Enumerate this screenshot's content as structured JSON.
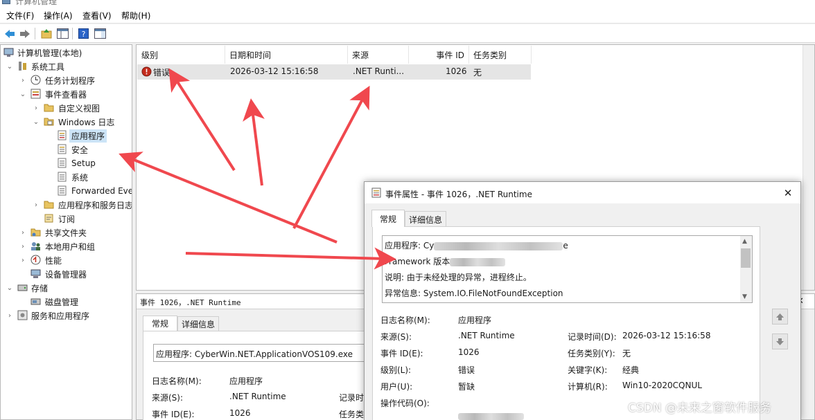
{
  "window": {
    "title": "计算机管理"
  },
  "menu": [
    "文件(F)",
    "操作(A)",
    "查看(V)",
    "帮助(H)"
  ],
  "toolbar_icons": [
    "back-arrow-icon",
    "forward-arrow-icon",
    "up-folder-icon",
    "show-tree-icon",
    "help-icon",
    "action-pane-icon"
  ],
  "tree": {
    "root": "计算机管理(本地)",
    "system_tools": "系统工具",
    "task_scheduler": "任务计划程序",
    "event_viewer": "事件查看器",
    "custom_views": "自定义视图",
    "windows_logs": "Windows 日志",
    "application": "应用程序",
    "security": "安全",
    "setup": "Setup",
    "system": "系统",
    "forwarded": "Forwarded Eve",
    "app_service_logs": "应用程序和服务日志",
    "subscriptions": "订阅",
    "shared_folders": "共享文件夹",
    "local_users": "本地用户和组",
    "performance": "性能",
    "device_manager": "设备管理器",
    "storage": "存储",
    "disk_mgmt": "磁盘管理",
    "services_apps": "服务和应用程序"
  },
  "list": {
    "headers": [
      "级别",
      "日期和时间",
      "来源",
      "事件 ID",
      "任务类别"
    ],
    "row": {
      "level": "错误",
      "datetime": "2026-03-12 15:16:58",
      "source": ".NET Runti...",
      "event_id": "1026",
      "task": "无"
    }
  },
  "preview": {
    "title": "事件 1026，.NET Runtime",
    "tabs": [
      "常规",
      "详细信息"
    ],
    "app_line": "应用程序: CyberWin.NET.ApplicationVOS109.exe",
    "log_name_label": "日志名称(M):",
    "log_name": "应用程序",
    "source_label": "来源(S):",
    "source": ".NET Runtime",
    "event_id_label": "事件 ID(E):",
    "event_id": "1026",
    "recorded_label": "记录时",
    "task_label": "任务类"
  },
  "dialog": {
    "title": "事件属性 - 事件 1026，.NET Runtime",
    "close": "✕",
    "tabs": [
      "常规",
      "详细信息"
    ],
    "desc": {
      "line1_prefix": "应用程序: Cy",
      "line1_suffix": "e",
      "line2_prefix": "Framework 版本",
      "line3": "说明: 由于未经处理的异常，进程终止。",
      "line4": "异常信息: System.IO.FileNotFoundException"
    },
    "fields": {
      "log_name_label": "日志名称(M):",
      "log_name": "应用程序",
      "source_label": "来源(S):",
      "source": ".NET Runtime",
      "recorded_label": "记录时间(D):",
      "recorded": "2026-03-12 15:16:58",
      "event_id_label": "事件 ID(E):",
      "event_id": "1026",
      "task_label": "任务类别(Y):",
      "task": "无",
      "level_label": "级别(L):",
      "level": "错误",
      "keywords_label": "关键字(K):",
      "keywords": "经典",
      "user_label": "用户(U):",
      "user": "暂缺",
      "computer_label": "计算机(R):",
      "computer": "Win10-2020CQNUL",
      "opcode_label": "操作代码(O):"
    }
  },
  "watermark": "CSDN @未来之窗软件服务",
  "colors": {
    "arrow": "#f0484e",
    "selection": "#cce4f7",
    "error": "#c42b1c"
  }
}
